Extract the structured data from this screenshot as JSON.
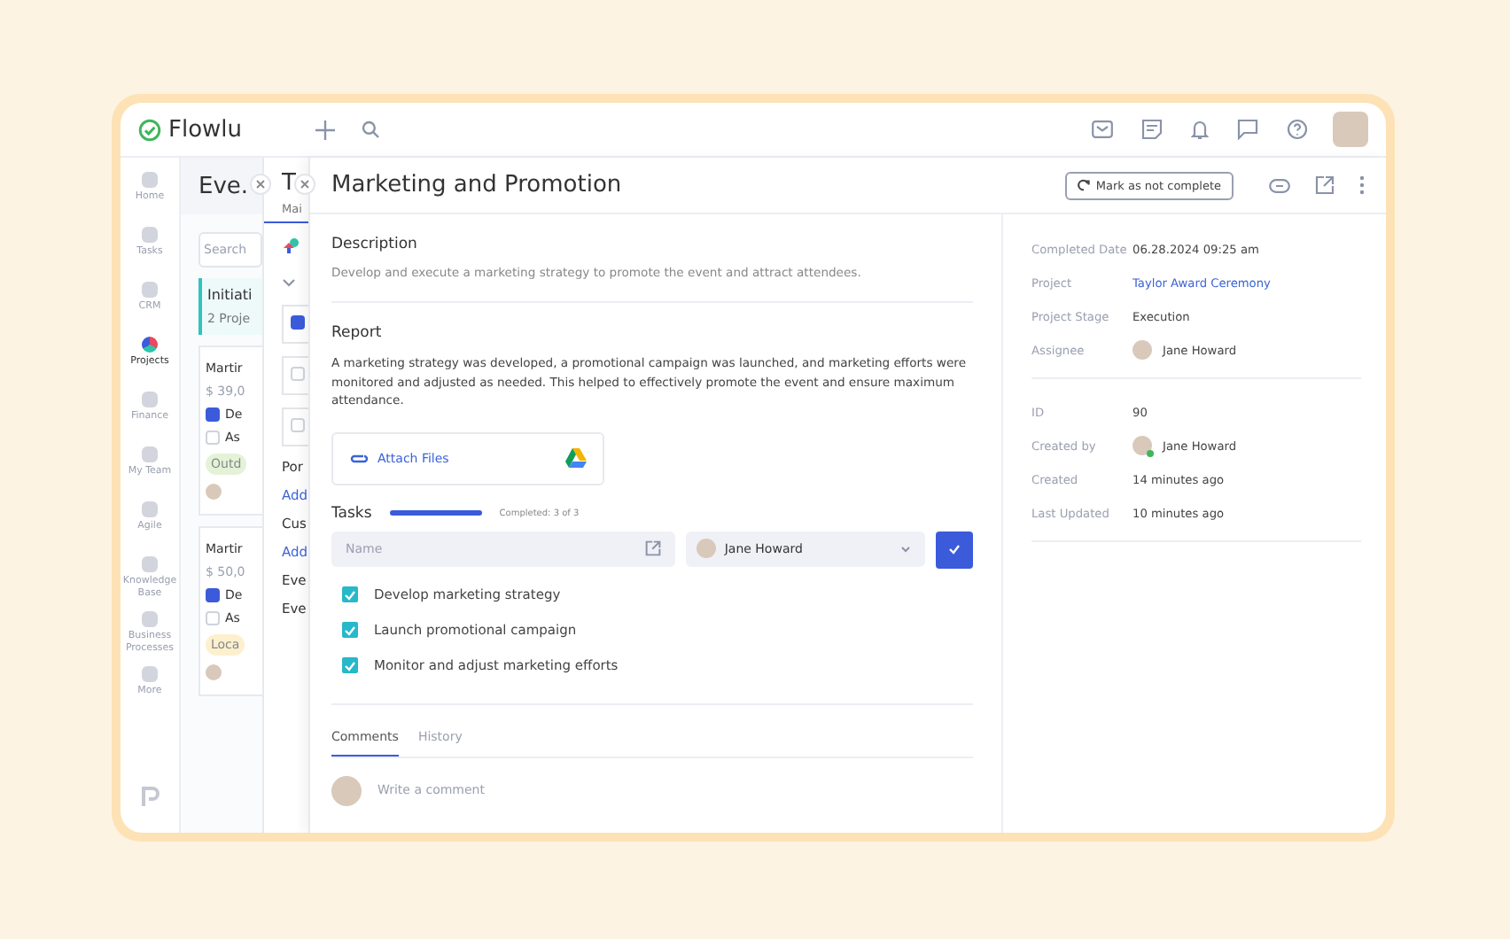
{
  "app": {
    "logo": "Flowlu"
  },
  "sidebar": {
    "items": [
      {
        "label": "Home",
        "selected": false
      },
      {
        "label": "Tasks",
        "selected": false
      },
      {
        "label": "CRM",
        "selected": false
      },
      {
        "label": "Projects",
        "selected": true
      },
      {
        "label": "Finance",
        "selected": false
      },
      {
        "label": "My Team",
        "selected": false
      },
      {
        "label": "Agile",
        "selected": false
      },
      {
        "label": "Knowledge Base",
        "selected": false
      },
      {
        "label": "Business Processes",
        "selected": false
      },
      {
        "label": "More",
        "selected": false
      }
    ]
  },
  "back_panel": {
    "title": "Eve.",
    "search_placeholder": "Search",
    "stage": {
      "title": "Initiati",
      "count": "2 Proje"
    },
    "cards": [
      {
        "title": "Martir",
        "amount": "$ 39,0",
        "tasks": [
          {
            "label": "De",
            "checked": true
          },
          {
            "label": "As",
            "checked": false
          }
        ],
        "tag": {
          "label": "Outd",
          "color": "#e4f3d8"
        }
      },
      {
        "title": "Martir",
        "amount": "$ 50,0",
        "tasks": [
          {
            "label": "De",
            "checked": true
          },
          {
            "label": "As",
            "checked": false
          }
        ],
        "tag": {
          "label": "Loca",
          "color": "#fdf0cf"
        }
      }
    ]
  },
  "middle_panel": {
    "title": "T",
    "tab": "Mai",
    "checks": [
      {
        "checked": true
      },
      {
        "checked": false
      },
      {
        "checked": false
      }
    ],
    "sections": [
      {
        "kind": "heading",
        "text": "Por"
      },
      {
        "kind": "link",
        "text": "Add"
      },
      {
        "kind": "heading",
        "text": "Cus"
      },
      {
        "kind": "link",
        "text": "Add"
      },
      {
        "kind": "heading",
        "text": "Eve"
      },
      {
        "kind": "heading",
        "text": "Eve"
      }
    ]
  },
  "task": {
    "title": "Marketing and Promotion",
    "mark_button": "Mark as not complete",
    "description": {
      "heading": "Description",
      "text": "Develop and execute a marketing strategy to promote the event and attract attendees."
    },
    "report": {
      "heading": "Report",
      "text": "A marketing strategy was developed, a promotional campaign was launched, and marketing efforts were monitored and adjusted as needed. This helped to effectively promote the event and ensure maximum attendance."
    },
    "attach": "Attach Files",
    "subtasks": {
      "heading": "Tasks",
      "level": 1,
      "progress_text": "Completed: 3 of 3",
      "name_placeholder": "Name",
      "assignee": "Jane Howard",
      "items": [
        {
          "label": "Develop marketing strategy",
          "checked": true
        },
        {
          "label": "Launch promotional campaign",
          "checked": true
        },
        {
          "label": "Monitor and adjust marketing efforts",
          "checked": true
        }
      ]
    },
    "tabs": [
      {
        "label": "Comments",
        "selected": true
      },
      {
        "label": "History",
        "selected": false
      }
    ],
    "comment_placeholder": "Write a comment"
  },
  "details": {
    "groups": [
      [
        {
          "label": "Completed Date",
          "kind": "text",
          "value": "06.28.2024 09:25 am"
        },
        {
          "label": "Project",
          "kind": "link",
          "value": "Taylor Award Ceremony"
        },
        {
          "label": "Project Stage",
          "kind": "text",
          "value": "Execution"
        },
        {
          "label": "Assignee",
          "kind": "person",
          "value": "Jane Howard",
          "online": false
        }
      ],
      [
        {
          "label": "ID",
          "kind": "text",
          "value": "90"
        },
        {
          "label": "Created by",
          "kind": "person",
          "value": "Jane Howard",
          "online": true
        },
        {
          "label": "Created",
          "kind": "text",
          "value": "14 minutes ago"
        },
        {
          "label": "Last Updated",
          "kind": "text",
          "value": "10 minutes ago"
        }
      ]
    ]
  }
}
